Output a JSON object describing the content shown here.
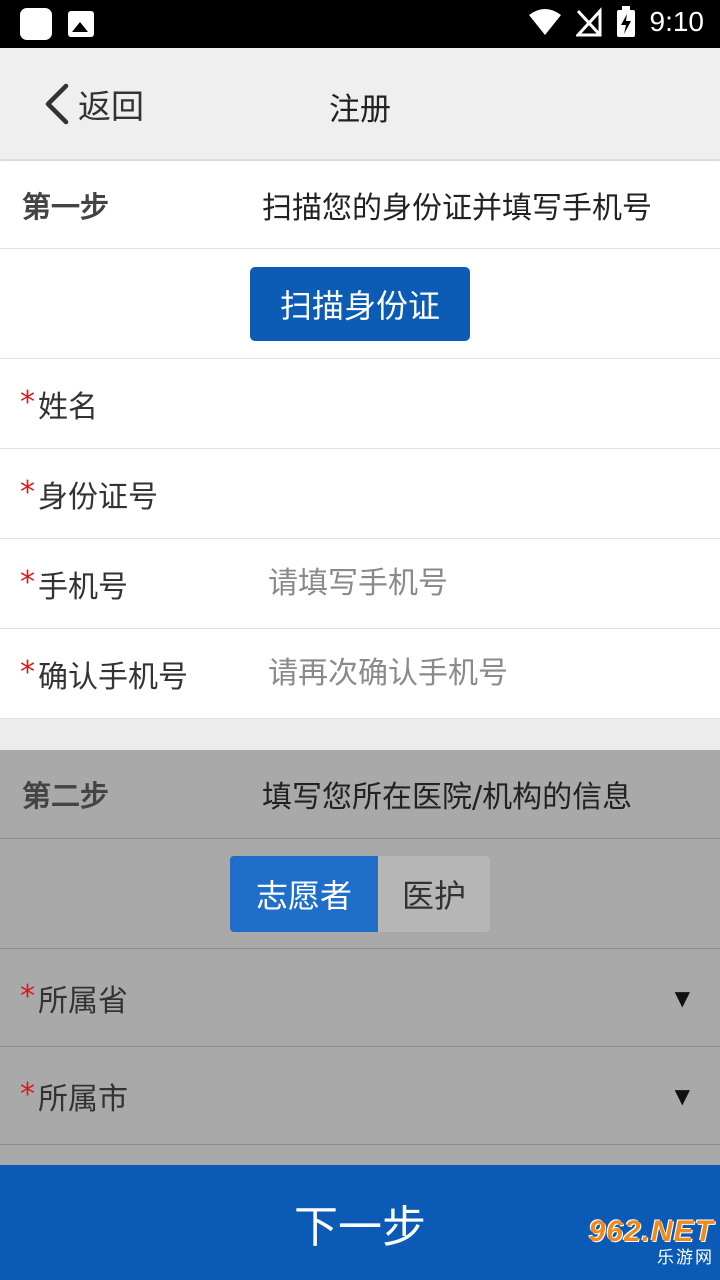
{
  "status_bar": {
    "time": "9:10",
    "icons": [
      "app-icon",
      "image-icon",
      "wifi-icon",
      "no-signal-icon",
      "battery-charging-icon"
    ]
  },
  "header": {
    "back_label": "返回",
    "title": "注册"
  },
  "step1": {
    "label": "第一步",
    "description": "扫描您的身份证并填写手机号",
    "scan_button": "扫描身份证",
    "fields": [
      {
        "required": "*",
        "label": "姓名",
        "placeholder": ""
      },
      {
        "required": "*",
        "label": "身份证号",
        "placeholder": ""
      },
      {
        "required": "*",
        "label": "手机号",
        "placeholder": "请填写手机号"
      },
      {
        "required": "*",
        "label": "确认手机号",
        "placeholder": "请再次确认手机号"
      }
    ]
  },
  "step2": {
    "label": "第二步",
    "description": "填写您所在医院/机构的信息",
    "roles": [
      {
        "label": "志愿者",
        "selected": true
      },
      {
        "label": "医护",
        "selected": false
      }
    ],
    "selects": [
      {
        "required": "*",
        "label": "所属省",
        "arrow": "▼"
      },
      {
        "required": "*",
        "label": "所属市",
        "arrow": "▼"
      }
    ]
  },
  "next_button": "下一步",
  "watermark": {
    "top": "962.NET",
    "bottom": "乐游网"
  },
  "colors": {
    "primary": "#0b5ab5",
    "required": "#d61c1c",
    "disabled_overlay": "#a9a9a9"
  }
}
